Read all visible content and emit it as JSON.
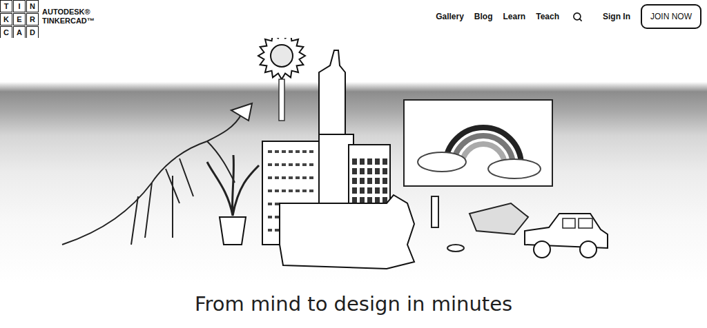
{
  "logo": {
    "letters": [
      "T",
      "I",
      "N",
      "K",
      "E",
      "R",
      "C",
      "A",
      "D"
    ],
    "brand": [
      "AUTODESK®",
      "TINKERCAD™"
    ]
  },
  "nav": {
    "items": [
      "Gallery",
      "Blog",
      "Learn",
      "Teach"
    ],
    "sign_in": "Sign In",
    "join": "JOIN NOW"
  },
  "hero": {
    "heading": "From mind to design in minutes"
  }
}
